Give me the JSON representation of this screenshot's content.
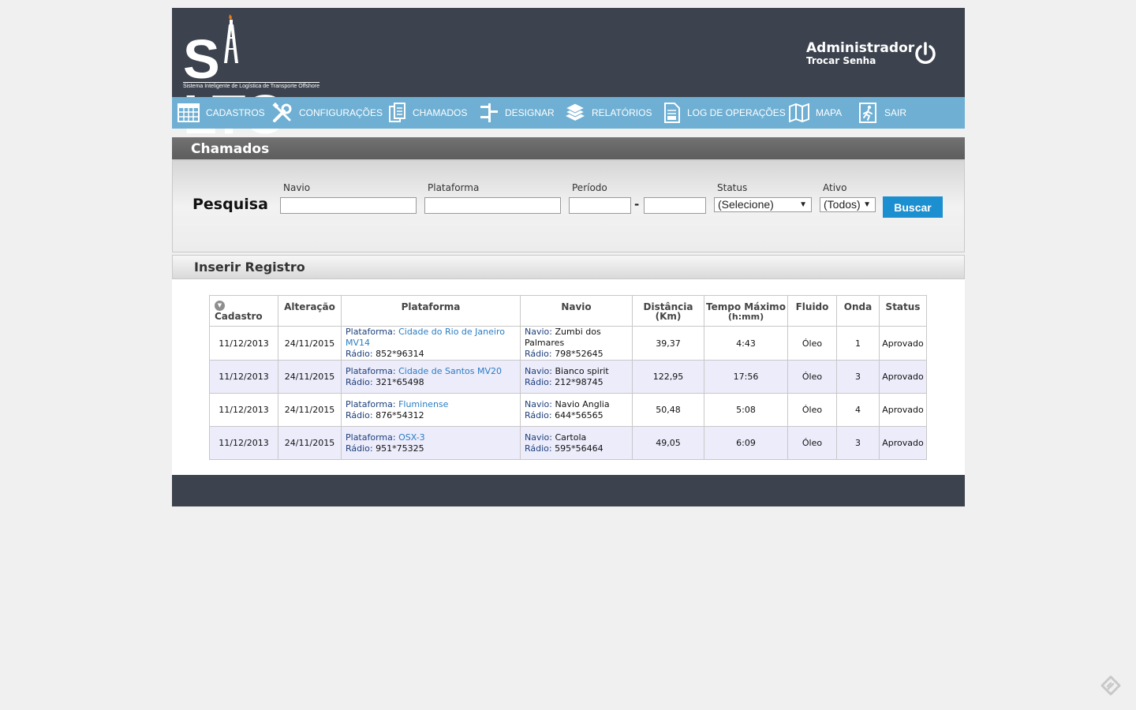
{
  "header": {
    "logo_text_left": "S",
    "logo_text_right": "LTO",
    "logo_tagline": "Sistema Inteligente de Logística de Transporte Offshore",
    "user_name": "Administrador",
    "change_password": "Trocar Senha"
  },
  "nav": {
    "items": [
      {
        "label": "CADASTROS",
        "icon": "table-icon"
      },
      {
        "label": "CONFIGURAÇÕES",
        "icon": "tools-icon"
      },
      {
        "label": "CHAMADOS",
        "icon": "documents-icon"
      },
      {
        "label": "DESIGNAR",
        "icon": "assign-icon"
      },
      {
        "label": "RELATÓRIOS",
        "icon": "stack-icon"
      },
      {
        "label": "LOG DE OPERAÇÕES",
        "icon": "log-icon"
      },
      {
        "label": "MAPA",
        "icon": "map-icon"
      },
      {
        "label": "SAIR",
        "icon": "exit-icon"
      }
    ]
  },
  "page": {
    "title": "Chamados",
    "insert_label": "Inserir Registro"
  },
  "search": {
    "title": "Pesquisa",
    "navio_label": "Navio",
    "navio_value": "",
    "plataforma_label": "Plataforma",
    "plataforma_value": "",
    "periodo_label": "Período",
    "periodo_start": "",
    "periodo_end": "",
    "periodo_separator": "-",
    "status_label": "Status",
    "status_value": "(Selecione)",
    "ativo_label": "Ativo",
    "ativo_value": "(Todos)",
    "button": "Buscar"
  },
  "table": {
    "columns": [
      "Cadastro",
      "Alteração",
      "Plataforma",
      "Navio",
      "Distância (Km)",
      "Tempo Máximo",
      "(h:mm)",
      "Fluido",
      "Onda",
      "Status"
    ],
    "plataforma_label": "Plataforma:",
    "radio_label": "Rádio:",
    "navio_label": "Navio:",
    "rows": [
      {
        "cadastro": "11/12/2013",
        "alteracao": "24/11/2015",
        "plataforma": "Cidade do Rio de Janeiro MV14",
        "plataforma_radio": "852*96314",
        "navio": "Zumbi dos Palmares",
        "navio_radio": "798*52645",
        "distancia": "39,37",
        "tempo": "4:43",
        "fluido": "Óleo",
        "onda": "1",
        "status": "Aprovado"
      },
      {
        "cadastro": "11/12/2013",
        "alteracao": "24/11/2015",
        "plataforma": "Cidade de Santos MV20",
        "plataforma_radio": "321*65498",
        "navio": "Bianco spirit",
        "navio_radio": "212*98745",
        "distancia": "122,95",
        "tempo": "17:56",
        "fluido": "Óleo",
        "onda": "3",
        "status": "Aprovado"
      },
      {
        "cadastro": "11/12/2013",
        "alteracao": "24/11/2015",
        "plataforma": "Fluminense",
        "plataforma_radio": "876*54312",
        "navio": "Navio Anglia",
        "navio_radio": "644*56565",
        "distancia": "50,48",
        "tempo": "5:08",
        "fluido": "Óleo",
        "onda": "4",
        "status": "Aprovado"
      },
      {
        "cadastro": "11/12/2013",
        "alteracao": "24/11/2015",
        "plataforma": "OSX-3",
        "plataforma_radio": "951*75325",
        "navio": "Cartola",
        "navio_radio": "595*56464",
        "distancia": "49,05",
        "tempo": "6:09",
        "fluido": "Óleo",
        "onda": "3",
        "status": "Aprovado"
      }
    ]
  },
  "colors": {
    "header_bg": "#3c434f",
    "nav_bg": "#6eafd3",
    "button_bg": "#1b8fd0",
    "row_alt_bg": "#ececfb",
    "link": "#2a7cc4"
  }
}
